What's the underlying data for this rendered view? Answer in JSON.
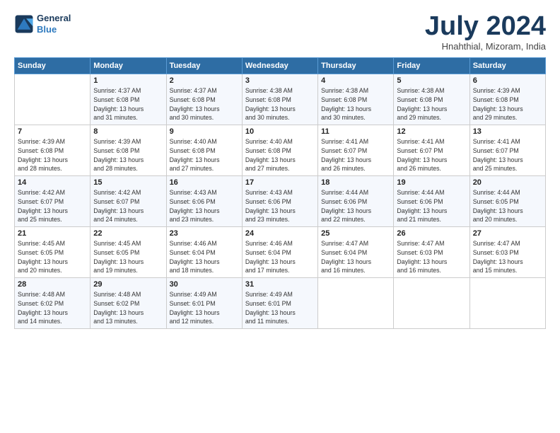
{
  "header": {
    "logo_line1": "General",
    "logo_line2": "Blue",
    "month_year": "July 2024",
    "location": "Hnahthial, Mizoram, India"
  },
  "weekdays": [
    "Sunday",
    "Monday",
    "Tuesday",
    "Wednesday",
    "Thursday",
    "Friday",
    "Saturday"
  ],
  "weeks": [
    [
      {
        "day": "",
        "info": ""
      },
      {
        "day": "1",
        "info": "Sunrise: 4:37 AM\nSunset: 6:08 PM\nDaylight: 13 hours\nand 31 minutes."
      },
      {
        "day": "2",
        "info": "Sunrise: 4:37 AM\nSunset: 6:08 PM\nDaylight: 13 hours\nand 30 minutes."
      },
      {
        "day": "3",
        "info": "Sunrise: 4:38 AM\nSunset: 6:08 PM\nDaylight: 13 hours\nand 30 minutes."
      },
      {
        "day": "4",
        "info": "Sunrise: 4:38 AM\nSunset: 6:08 PM\nDaylight: 13 hours\nand 30 minutes."
      },
      {
        "day": "5",
        "info": "Sunrise: 4:38 AM\nSunset: 6:08 PM\nDaylight: 13 hours\nand 29 minutes."
      },
      {
        "day": "6",
        "info": "Sunrise: 4:39 AM\nSunset: 6:08 PM\nDaylight: 13 hours\nand 29 minutes."
      }
    ],
    [
      {
        "day": "7",
        "info": "Sunrise: 4:39 AM\nSunset: 6:08 PM\nDaylight: 13 hours\nand 28 minutes."
      },
      {
        "day": "8",
        "info": "Sunrise: 4:39 AM\nSunset: 6:08 PM\nDaylight: 13 hours\nand 28 minutes."
      },
      {
        "day": "9",
        "info": "Sunrise: 4:40 AM\nSunset: 6:08 PM\nDaylight: 13 hours\nand 27 minutes."
      },
      {
        "day": "10",
        "info": "Sunrise: 4:40 AM\nSunset: 6:08 PM\nDaylight: 13 hours\nand 27 minutes."
      },
      {
        "day": "11",
        "info": "Sunrise: 4:41 AM\nSunset: 6:07 PM\nDaylight: 13 hours\nand 26 minutes."
      },
      {
        "day": "12",
        "info": "Sunrise: 4:41 AM\nSunset: 6:07 PM\nDaylight: 13 hours\nand 26 minutes."
      },
      {
        "day": "13",
        "info": "Sunrise: 4:41 AM\nSunset: 6:07 PM\nDaylight: 13 hours\nand 25 minutes."
      }
    ],
    [
      {
        "day": "14",
        "info": "Sunrise: 4:42 AM\nSunset: 6:07 PM\nDaylight: 13 hours\nand 25 minutes."
      },
      {
        "day": "15",
        "info": "Sunrise: 4:42 AM\nSunset: 6:07 PM\nDaylight: 13 hours\nand 24 minutes."
      },
      {
        "day": "16",
        "info": "Sunrise: 4:43 AM\nSunset: 6:06 PM\nDaylight: 13 hours\nand 23 minutes."
      },
      {
        "day": "17",
        "info": "Sunrise: 4:43 AM\nSunset: 6:06 PM\nDaylight: 13 hours\nand 23 minutes."
      },
      {
        "day": "18",
        "info": "Sunrise: 4:44 AM\nSunset: 6:06 PM\nDaylight: 13 hours\nand 22 minutes."
      },
      {
        "day": "19",
        "info": "Sunrise: 4:44 AM\nSunset: 6:06 PM\nDaylight: 13 hours\nand 21 minutes."
      },
      {
        "day": "20",
        "info": "Sunrise: 4:44 AM\nSunset: 6:05 PM\nDaylight: 13 hours\nand 20 minutes."
      }
    ],
    [
      {
        "day": "21",
        "info": "Sunrise: 4:45 AM\nSunset: 6:05 PM\nDaylight: 13 hours\nand 20 minutes."
      },
      {
        "day": "22",
        "info": "Sunrise: 4:45 AM\nSunset: 6:05 PM\nDaylight: 13 hours\nand 19 minutes."
      },
      {
        "day": "23",
        "info": "Sunrise: 4:46 AM\nSunset: 6:04 PM\nDaylight: 13 hours\nand 18 minutes."
      },
      {
        "day": "24",
        "info": "Sunrise: 4:46 AM\nSunset: 6:04 PM\nDaylight: 13 hours\nand 17 minutes."
      },
      {
        "day": "25",
        "info": "Sunrise: 4:47 AM\nSunset: 6:04 PM\nDaylight: 13 hours\nand 16 minutes."
      },
      {
        "day": "26",
        "info": "Sunrise: 4:47 AM\nSunset: 6:03 PM\nDaylight: 13 hours\nand 16 minutes."
      },
      {
        "day": "27",
        "info": "Sunrise: 4:47 AM\nSunset: 6:03 PM\nDaylight: 13 hours\nand 15 minutes."
      }
    ],
    [
      {
        "day": "28",
        "info": "Sunrise: 4:48 AM\nSunset: 6:02 PM\nDaylight: 13 hours\nand 14 minutes."
      },
      {
        "day": "29",
        "info": "Sunrise: 4:48 AM\nSunset: 6:02 PM\nDaylight: 13 hours\nand 13 minutes."
      },
      {
        "day": "30",
        "info": "Sunrise: 4:49 AM\nSunset: 6:01 PM\nDaylight: 13 hours\nand 12 minutes."
      },
      {
        "day": "31",
        "info": "Sunrise: 4:49 AM\nSunset: 6:01 PM\nDaylight: 13 hours\nand 11 minutes."
      },
      {
        "day": "",
        "info": ""
      },
      {
        "day": "",
        "info": ""
      },
      {
        "day": "",
        "info": ""
      }
    ]
  ]
}
